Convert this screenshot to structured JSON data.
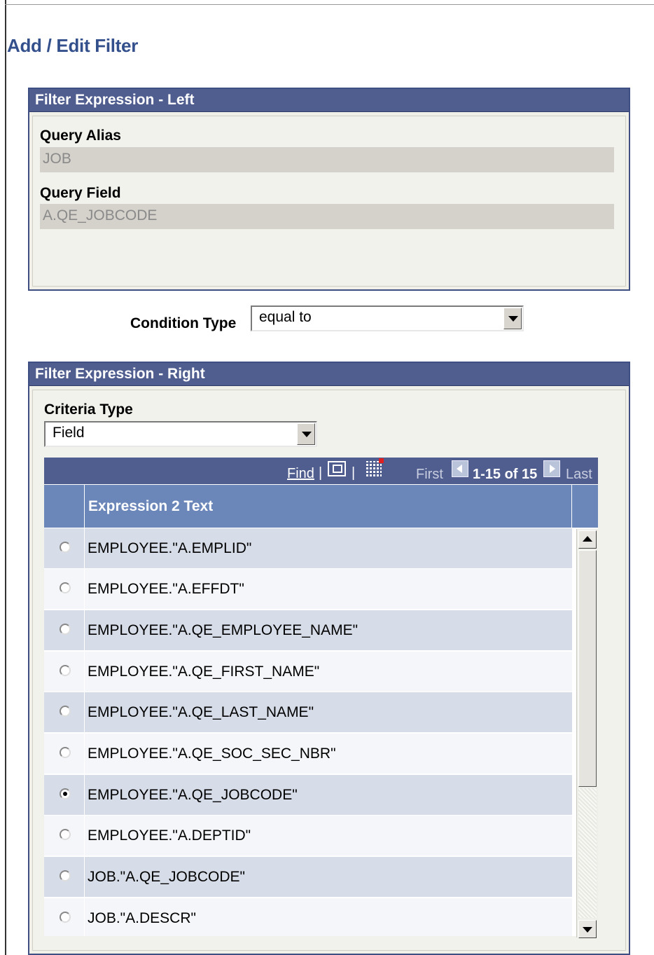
{
  "page": {
    "title": "Add / Edit Filter"
  },
  "left_expression": {
    "header": "Filter Expression - Left",
    "query_alias_label": "Query Alias",
    "query_alias_value": "JOB",
    "query_field_label": "Query Field",
    "query_field_value": "A.QE_JOBCODE"
  },
  "condition": {
    "label": "Condition Type",
    "value": "equal to"
  },
  "right_expression": {
    "header": "Filter Expression - Right",
    "criteria_type_label": "Criteria Type",
    "criteria_type_value": "Field"
  },
  "grid": {
    "find_label": "Find",
    "separator": "|",
    "first_label": "First",
    "range_label": "1-15 of 15",
    "last_label": "Last",
    "column_header": "Expression 2 Text",
    "rows": [
      {
        "text": "EMPLOYEE.\"A.EMPLID\"",
        "selected": false
      },
      {
        "text": "EMPLOYEE.\"A.EFFDT\"",
        "selected": false
      },
      {
        "text": "EMPLOYEE.\"A.QE_EMPLOYEE_NAME\"",
        "selected": false
      },
      {
        "text": "EMPLOYEE.\"A.QE_FIRST_NAME\"",
        "selected": false
      },
      {
        "text": "EMPLOYEE.\"A.QE_LAST_NAME\"",
        "selected": false
      },
      {
        "text": "EMPLOYEE.\"A.QE_SOC_SEC_NBR\"",
        "selected": false
      },
      {
        "text": "EMPLOYEE.\"A.QE_JOBCODE\"",
        "selected": true
      },
      {
        "text": "EMPLOYEE.\"A.DEPTID\"",
        "selected": false
      },
      {
        "text": "JOB.\"A.QE_JOBCODE\"",
        "selected": false
      },
      {
        "text": "JOB.\"A.DESCR\"",
        "selected": false
      }
    ]
  },
  "icons": {
    "zoom": "new-window-icon",
    "download": "spreadsheet-download-icon",
    "prev": "previous-arrow-icon",
    "next": "next-arrow-icon",
    "dropdown": "chevron-down-icon"
  },
  "colors": {
    "title": "#33508c",
    "header_bar": "#4f5d8f",
    "grid_header": "#6b86b9",
    "row_alt": "#d6dde8",
    "row_plain": "#f4f6f9",
    "panel_bg": "#f0f0e8",
    "readonly_bg": "#d5d1cb"
  }
}
